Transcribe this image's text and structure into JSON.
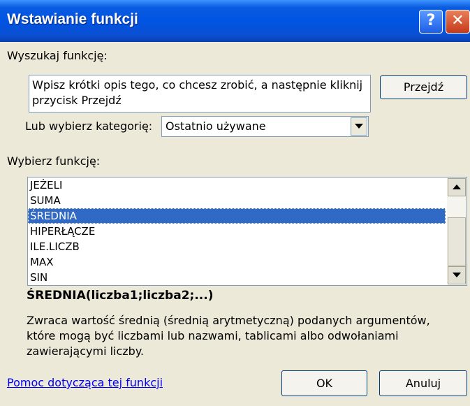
{
  "window": {
    "title": "Wstawianie funkcji",
    "help_label": "?",
    "close_label": "✕"
  },
  "search": {
    "label": "Wyszukaj funkcję:",
    "text": "Wpisz krótki opis tego, co chcesz zrobić, a następnie kliknij przycisk Przejdź",
    "go_button": "Przejdź"
  },
  "category": {
    "label": "Lub wybierz kategorię:",
    "selected": "Ostatnio używane"
  },
  "functions": {
    "label": "Wybierz funkcję:",
    "items": [
      "JEŻELI",
      "SUMA",
      "ŚREDNIA",
      "HIPERŁĄCZE",
      "ILE.LICZB",
      "MAX",
      "SIN"
    ],
    "selected_index": 2
  },
  "info": {
    "signature": "ŚREDNIA(liczba1;liczba2;...)",
    "description": "Zwraca wartość średnią (średnią arytmetyczną) podanych argumentów, które mogą być liczbami lub nazwami, tablicami albo odwołaniami zawierającymi liczby."
  },
  "footer": {
    "help_link": "Pomoc dotycząca tej funkcji",
    "ok": "OK",
    "cancel": "Anuluj"
  }
}
